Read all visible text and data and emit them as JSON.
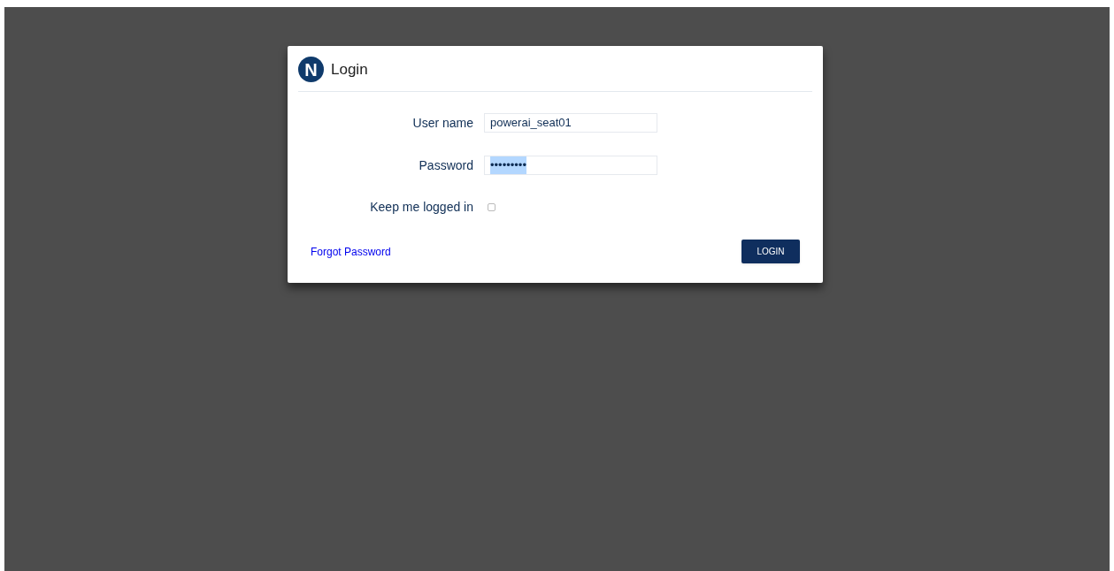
{
  "dialog": {
    "title": "Login",
    "logo_letter": "N"
  },
  "fields": [
    {
      "label": "User name",
      "value": "powerai_seat01",
      "text_selected": false
    },
    {
      "label": "Password",
      "value": "•••••••••",
      "text_selected": true
    }
  ],
  "keep_logged_in": {
    "label": "Keep me logged in",
    "checked": false
  },
  "forgot_link": "Forgot Password",
  "login_button": "LOGIN"
}
